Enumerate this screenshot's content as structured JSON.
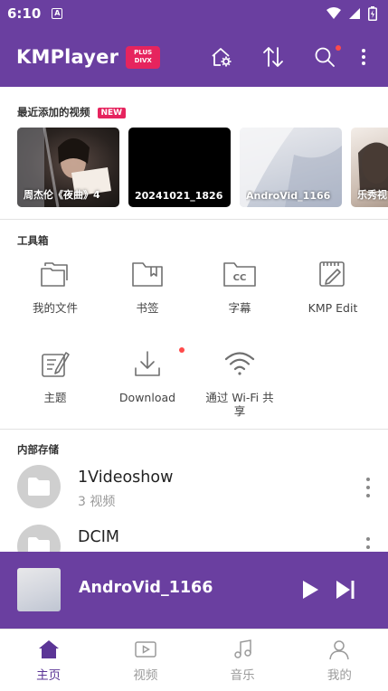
{
  "status_bar": {
    "time": "6:10",
    "app_indicator": "A"
  },
  "header": {
    "logo_text": "KMPlayer",
    "badge_line1": "PLUS",
    "badge_line2": "DIVX",
    "icons": [
      "home-settings-icon",
      "sort-icon",
      "search-icon",
      "more-vertical-icon"
    ]
  },
  "recent": {
    "title": "最近添加的视频",
    "badge": "NEW",
    "items": [
      {
        "title": "周杰伦《夜曲》4"
      },
      {
        "title": "20241021_1826"
      },
      {
        "title": "AndroVid_1166"
      },
      {
        "title": "乐秀视"
      }
    ]
  },
  "toolbox": {
    "title": "工具箱",
    "items": [
      {
        "label": "我的文件",
        "icon": "folders-icon"
      },
      {
        "label": "书签",
        "icon": "bookmark-folder-icon"
      },
      {
        "label": "字幕",
        "icon": "subtitle-folder-icon"
      },
      {
        "label": "KMP Edit",
        "icon": "edit-icon"
      },
      {
        "label": "主题",
        "icon": "theme-icon"
      },
      {
        "label": "Download",
        "icon": "download-icon"
      },
      {
        "label": "通过 Wi-Fi 共享",
        "icon": "wifi-icon"
      }
    ]
  },
  "storage": {
    "title": "内部存储",
    "folders": [
      {
        "name": "1Videoshow",
        "count": "3 视频"
      },
      {
        "name": "DCIM",
        "count": ""
      }
    ]
  },
  "mini_player": {
    "title": "AndroVid_1166"
  },
  "bottom_nav": {
    "items": [
      {
        "label": "主页",
        "active": true
      },
      {
        "label": "视频",
        "active": false
      },
      {
        "label": "音乐",
        "active": false
      },
      {
        "label": "我的",
        "active": false
      }
    ]
  },
  "colors": {
    "brand": "#6a3fa0",
    "accent": "#e6245e",
    "active_nav": "#5b3596"
  }
}
